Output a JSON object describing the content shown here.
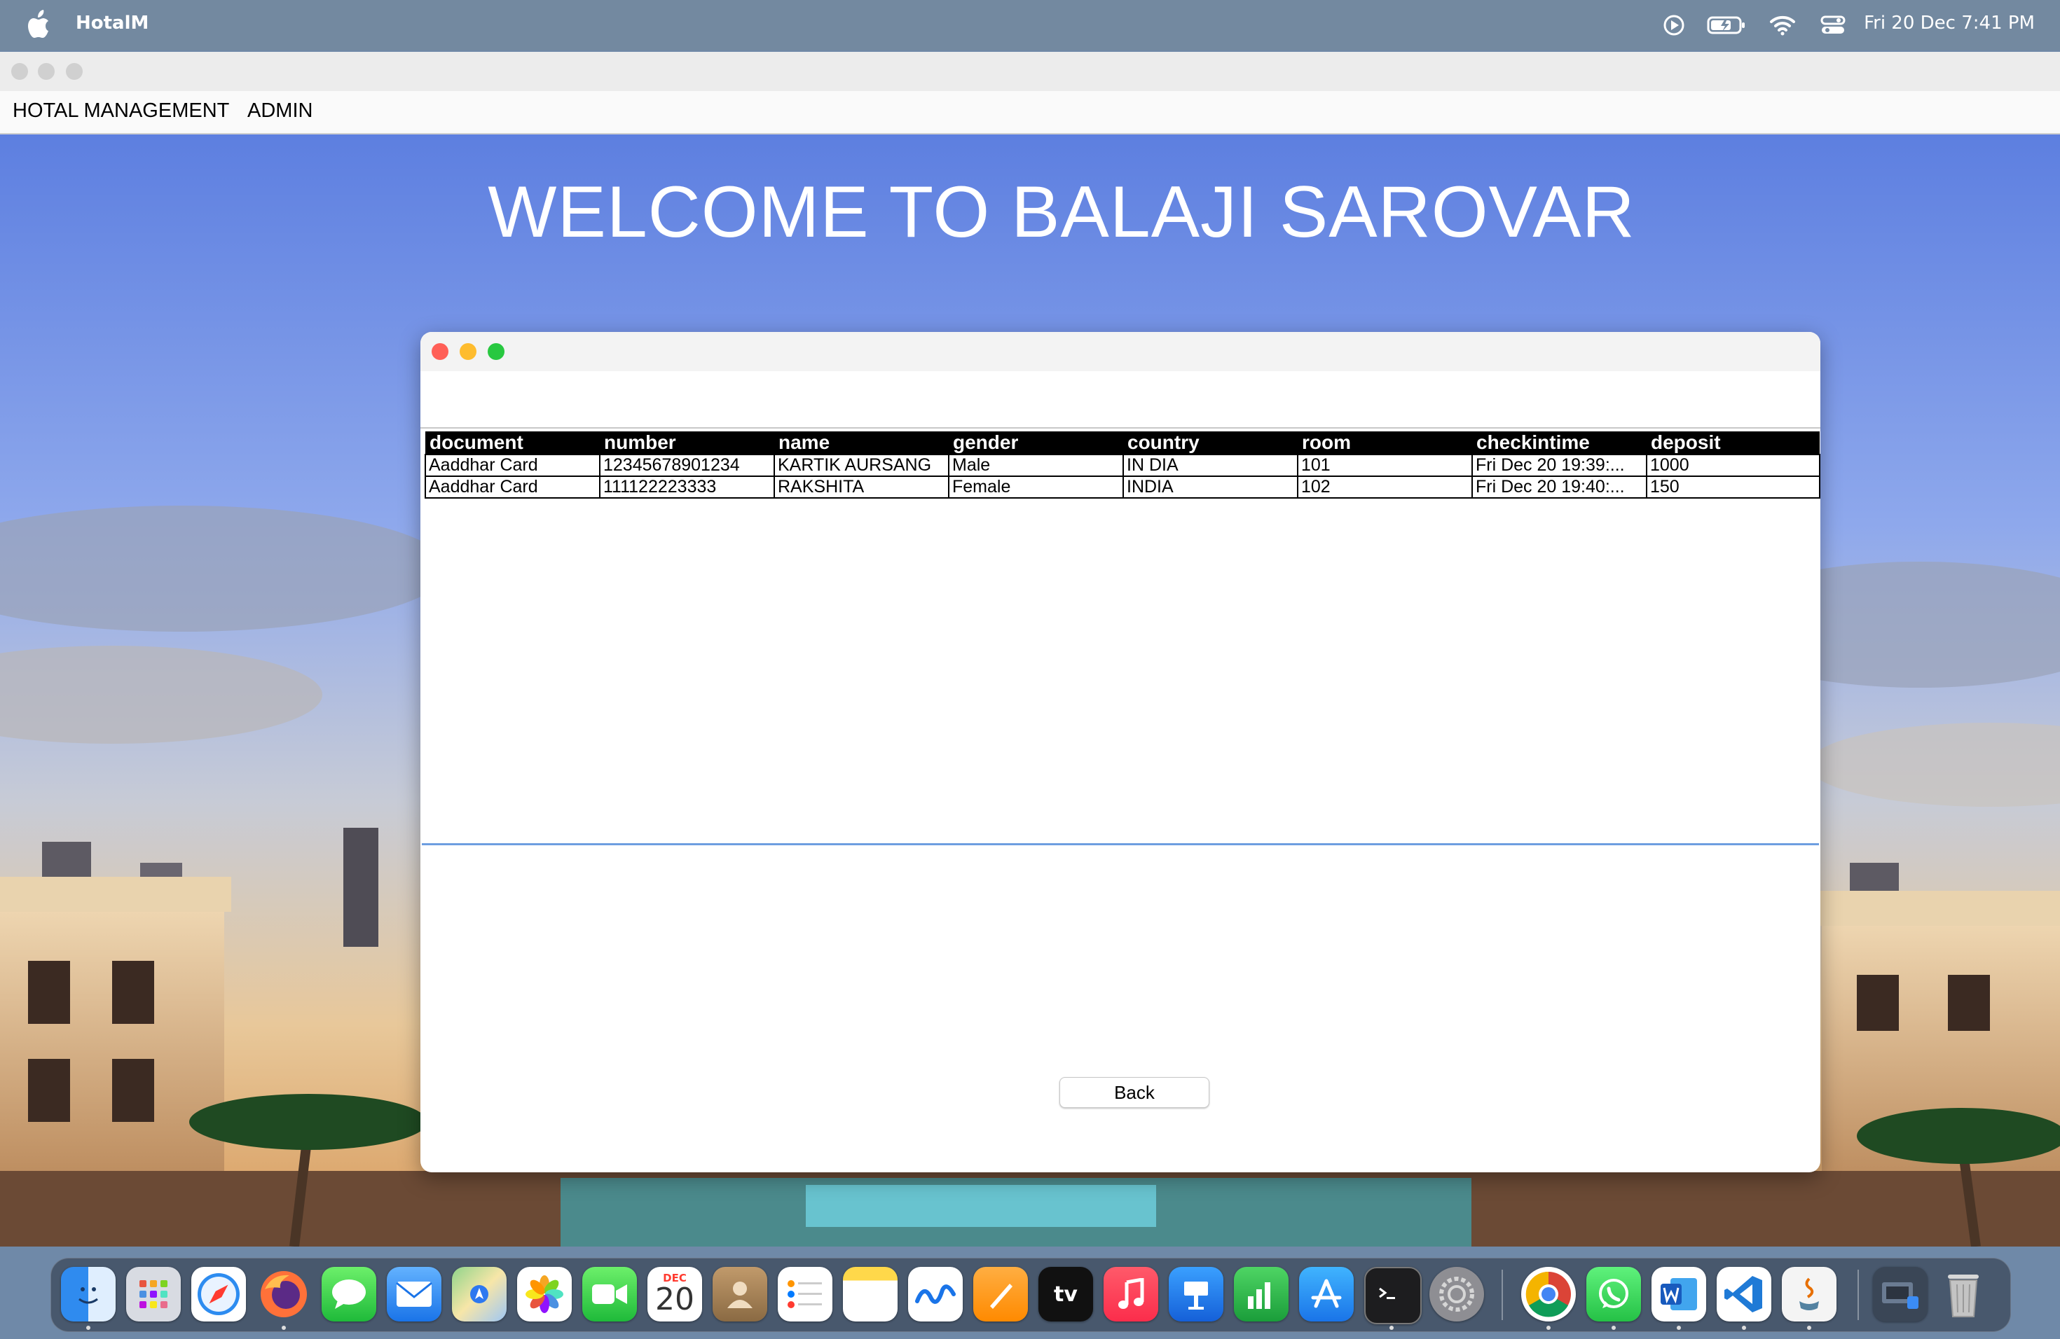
{
  "menubar": {
    "app_name": "HotalM",
    "clock": "Fri 20 Dec  7:41 PM",
    "status_icons": [
      "play-circle-icon",
      "battery-icon",
      "wifi-icon",
      "control-center-icon"
    ]
  },
  "app": {
    "menus": [
      "HOTAL MANAGEMENT",
      "ADMIN"
    ],
    "welcome": "WELCOME TO BALAJI SAROVAR"
  },
  "customer_table": {
    "columns": [
      "document",
      "number",
      "name",
      "gender",
      "country",
      "room",
      "checkintime",
      "deposit"
    ],
    "rows": [
      [
        "Aaddhar Card",
        "12345678901234",
        "KARTIK AURSANG",
        "Male",
        "IN DIA",
        "101",
        "Fri Dec 20 19:39:...",
        "1000"
      ],
      [
        "Aaddhar Card",
        "111122223333",
        "RAKSHITA",
        "Female",
        "INDIA",
        "102",
        "Fri Dec 20 19:40:...",
        "150"
      ]
    ]
  },
  "buttons": {
    "back": "Back"
  },
  "dock": {
    "calendar_month": "DEC",
    "calendar_day": "20",
    "apps": [
      "finder-icon",
      "launchpad-icon",
      "safari-icon",
      "firefox-icon",
      "messages-icon",
      "mail-icon",
      "maps-icon",
      "photos-icon",
      "facetime-icon",
      "calendar-icon",
      "contacts-icon",
      "reminders-icon",
      "notes-icon",
      "freeform-icon",
      "pages-icon",
      "appletv-icon",
      "music-icon",
      "keynote-icon",
      "numbers-icon",
      "appstore-icon",
      "terminal-icon",
      "system-settings-icon",
      "chrome-icon",
      "whatsapp-icon",
      "word-icon",
      "vscode-icon",
      "java-icon",
      "downloads-icon",
      "trash-icon"
    ]
  },
  "colors": {
    "table_header_bg": "#000000",
    "close": "#ff5f57",
    "minimize": "#febc2e",
    "zoom": "#28c840",
    "focus_border": "#6d9ee0"
  }
}
